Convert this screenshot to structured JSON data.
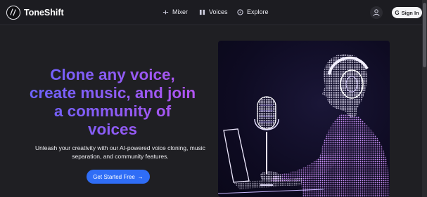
{
  "header": {
    "brand": "ToneShift",
    "nav": [
      {
        "label": "Mixer",
        "icon": "mixer-icon"
      },
      {
        "label": "Voices",
        "icon": "voices-icon"
      },
      {
        "label": "Explore",
        "icon": "explore-icon"
      }
    ],
    "signin_label": "Sign In",
    "signin_icon": "G"
  },
  "hero": {
    "title_lines": [
      "Clone any voice,",
      "create music, and join",
      "a community of",
      "voices"
    ],
    "subtitle_lines": [
      "Unleash your creativity with our AI-powered voice cloning, music",
      "separation, and community features."
    ],
    "cta_label": "Get Started Free",
    "cta_arrow": "→"
  },
  "colors": {
    "background": "#1f1f23",
    "accent": "#2f6df6",
    "gradient_start": "#6a63ff",
    "gradient_end": "#b453f0"
  }
}
